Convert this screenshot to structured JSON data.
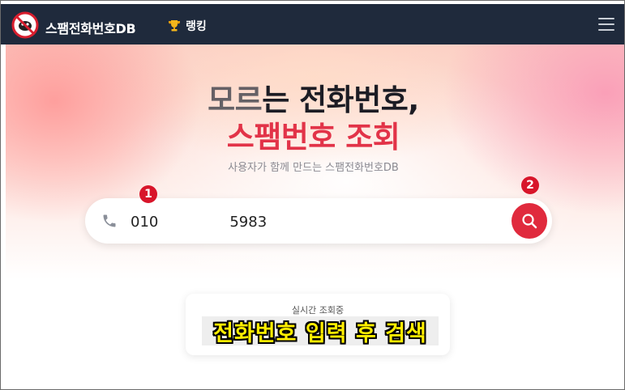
{
  "navbar": {
    "logo_text": "스팸전화번호DB",
    "ranking_label": "랭킹",
    "ranking_icon": "trophy-icon",
    "menu_icon": "hamburger-menu-icon",
    "logo_icon": "no-spam-logo-icon"
  },
  "hero": {
    "title_part1": "모르",
    "title_part2": "는 전화번호,",
    "title_line2": "스팸번호 조회",
    "subtitle": "사용자가 함께 만드는 스팸전화번호DB"
  },
  "search": {
    "value_prefix": "010",
    "value_suffix": "5983",
    "phone_icon": "phone-icon",
    "button_icon": "search-icon"
  },
  "annotations": {
    "badge_1": "1",
    "badge_2": "2",
    "caption": "전화번호 입력 후 검색"
  },
  "live": {
    "label": "실시간 조회중"
  },
  "colors": {
    "navbar": "#1f2a3c",
    "accent_red": "#e02a3d",
    "caption_yellow": "#ffee00"
  }
}
